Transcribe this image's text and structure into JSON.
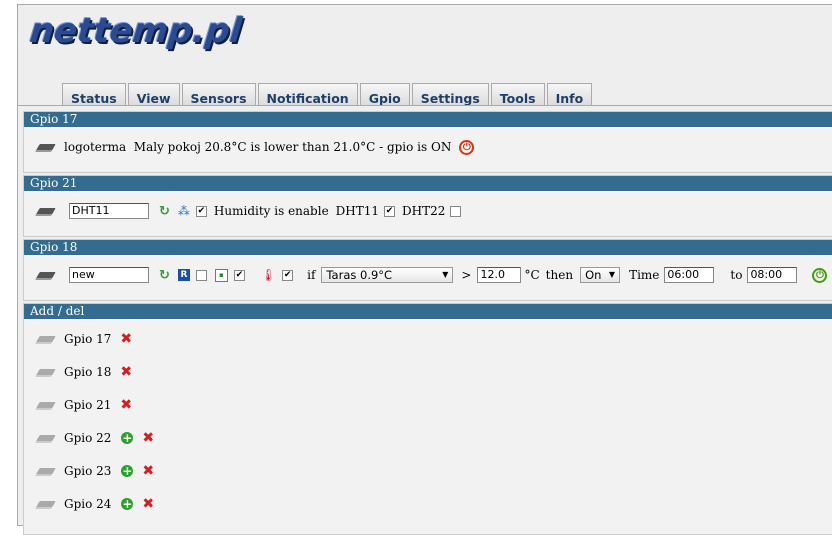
{
  "logo": "nettemp.pl",
  "tabs": [
    "Status",
    "View",
    "Sensors",
    "Notification",
    "Gpio",
    "Settings",
    "Tools",
    "Info"
  ],
  "gpio17": {
    "header": "Gpio 17",
    "text": "logoterma  Maly pokoj 20.8°C is lower than 21.0°C - gpio is ON"
  },
  "gpio21": {
    "header": "Gpio 21",
    "name_value": "DHT11",
    "humidity_label": "Humidity is enable",
    "dht11_label": "DHT11",
    "dht22_label": "DHT22"
  },
  "gpio18": {
    "header": "Gpio 18",
    "name_value": "new",
    "if_label": "if",
    "sensor_select": "Taras 0.9°C",
    "gt": ">",
    "temp_value": "12.0",
    "unit": "°C",
    "then_label": "then",
    "state_select": "On",
    "time_label": "Time",
    "time_from": "06:00",
    "to_label": "to",
    "time_to": "08:00"
  },
  "adddel": {
    "header": "Add / del",
    "items": [
      {
        "label": "Gpio 17",
        "add": false
      },
      {
        "label": "Gpio 18",
        "add": false
      },
      {
        "label": "Gpio 21",
        "add": false
      },
      {
        "label": "Gpio 22",
        "add": true
      },
      {
        "label": "Gpio 23",
        "add": true
      },
      {
        "label": "Gpio 24",
        "add": true
      }
    ]
  },
  "colors": {
    "header_bg": "#336c8f",
    "tab_text": "#1e3f6a",
    "delete": "#d02020",
    "add": "#2aa12a"
  }
}
